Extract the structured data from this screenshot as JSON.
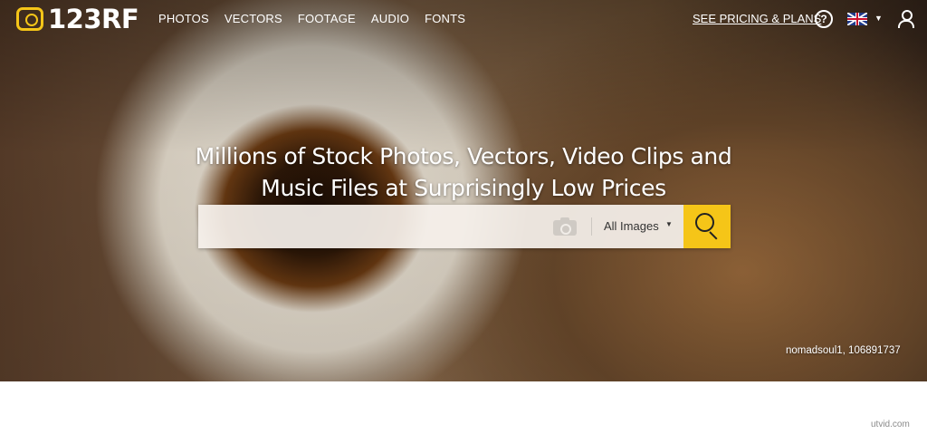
{
  "brand": {
    "logo_text": "123RF",
    "accent_color": "#f5c518"
  },
  "nav": {
    "links": [
      {
        "label": "PHOTOS"
      },
      {
        "label": "VECTORS"
      },
      {
        "label": "FOOTAGE"
      },
      {
        "label": "AUDIO"
      },
      {
        "label": "FONTS"
      }
    ],
    "pricing_label": "SEE PRICING & PLANS",
    "help_icon_glyph": "?",
    "language_icon": "uk-flag-icon",
    "user_icon": "user-icon"
  },
  "hero": {
    "headline": "Millions of Stock Photos, Vectors, Video Clips and Music Files at Surprisingly Low Prices",
    "credit": "nomadsoul1, 106891737"
  },
  "search": {
    "query_value": "",
    "placeholder": "",
    "type_selected": "All Images",
    "camera_icon": "camera-icon",
    "submit_icon": "search-icon"
  },
  "watermark": "utvid.com"
}
